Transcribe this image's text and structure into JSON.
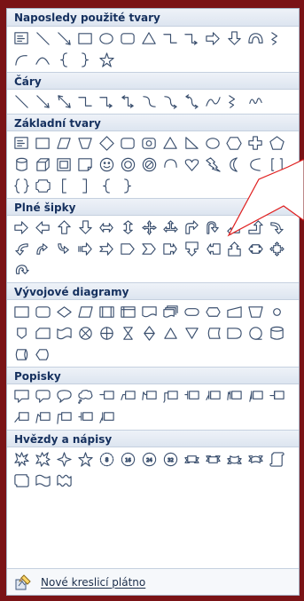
{
  "sections": [
    {
      "key": "recent",
      "title": "Naposledy použité tvary",
      "shapes": [
        "textbox",
        "line",
        "line-arrow",
        "rectangle",
        "oval",
        "rounded-rectangle",
        "triangle",
        "elbow-connector",
        "elbow-arrow-connector",
        "right-arrow",
        "down-arrow",
        "half-donut",
        "freeform",
        "curved-line",
        "arc-curve",
        "left-brace",
        "right-brace",
        "star"
      ]
    },
    {
      "key": "lines",
      "title": "Čáry",
      "shapes": [
        "line",
        "line-arrow",
        "line-double-arrow",
        "elbow-connector",
        "elbow-arrow-connector",
        "elbow-double-arrow",
        "curved-connector",
        "curved-arrow-connector",
        "curved-double-arrow",
        "curve",
        "freeform",
        "scribble"
      ]
    },
    {
      "key": "basic",
      "title": "Základní tvary",
      "shapes": [
        "textbox",
        "rectangle",
        "parallelogram",
        "trapezoid",
        "diamond",
        "rounded-rectangle",
        "octagon-plate",
        "triangle",
        "right-triangle",
        "oval",
        "hexagon",
        "cross",
        "pentagon",
        "can",
        "cube",
        "bevel",
        "folded-corner",
        "smiley",
        "donut",
        "no-symbol",
        "arc",
        "heart",
        "lightning",
        "moon",
        "curved-left",
        "bracket-pair",
        "brace-pair",
        "plaque",
        "left-bracket",
        "right-bracket",
        "left-brace",
        "right-brace"
      ]
    },
    {
      "key": "arrows",
      "title": "Plné šipky",
      "shapes": [
        "right-arrow",
        "left-arrow",
        "up-arrow",
        "down-arrow",
        "left-right-arrow",
        "up-down-arrow",
        "quad-arrow",
        "left-right-up-arrow",
        "bent-arrow",
        "u-turn-arrow",
        "left-up-arrow",
        "bent-up-arrow",
        "curved-right-arrow",
        "curved-left-arrow",
        "curved-up-arrow",
        "curved-down-arrow",
        "striped-right-arrow",
        "notched-right-arrow",
        "pentagon-arrow",
        "chevron",
        "right-arrow-callout",
        "down-arrow-callout",
        "left-arrow-callout",
        "up-arrow-callout",
        "left-right-arrow-callout",
        "quad-arrow-callout",
        "circular-arrow"
      ]
    },
    {
      "key": "flowchart",
      "title": "Vývojové diagramy",
      "shapes": [
        "flow-process",
        "flow-alternate-process",
        "flow-decision",
        "flow-data",
        "flow-predefined",
        "flow-internal-storage",
        "flow-document",
        "flow-multidocument",
        "flow-terminator",
        "flow-preparation",
        "flow-manual-input",
        "flow-manual-operation",
        "flow-connector",
        "flow-offpage",
        "flow-card",
        "flow-punched-tape",
        "flow-summing-junction",
        "flow-or",
        "flow-collate",
        "flow-sort",
        "flow-extract",
        "flow-merge",
        "flow-stored-data",
        "flow-delay",
        "flow-sequential-storage",
        "flow-magnetic-disk",
        "flow-direct-storage",
        "flow-display"
      ]
    },
    {
      "key": "callouts",
      "title": "Popisky",
      "shapes": [
        "rect-callout",
        "rounded-callout",
        "oval-callout",
        "cloud-callout",
        "line-callout-1",
        "line-callout-2",
        "line-callout-3",
        "line-callout-4",
        "accent-callout-1",
        "accent-callout-2",
        "accent-callout-3",
        "accent-callout-4",
        "border-callout-1",
        "border-callout-2",
        "border-callout-3",
        "border-callout-4",
        "accent-border-callout-1",
        "accent-border-callout-2"
      ]
    },
    {
      "key": "stars",
      "title": "Hvězdy a nápisy",
      "shapes": [
        "explosion-1",
        "explosion-2",
        "star-4",
        "star-5",
        "star-8",
        "star-16",
        "star-24",
        "star-32",
        "ribbon-down",
        "ribbon-up",
        "curved-ribbon-down",
        "curved-ribbon-up",
        "vertical-scroll",
        "horizontal-scroll",
        "wave",
        "double-wave"
      ]
    }
  ],
  "footer": {
    "label": "Nové kreslicí plátno",
    "icon": "drawing-canvas-icon"
  },
  "colors": {
    "background": "#7a1316",
    "header_text": "#15305e",
    "header_bg": "#e4eaf3",
    "shape_stroke": "#3a4f6e",
    "callout_line": "#e01f1f"
  }
}
